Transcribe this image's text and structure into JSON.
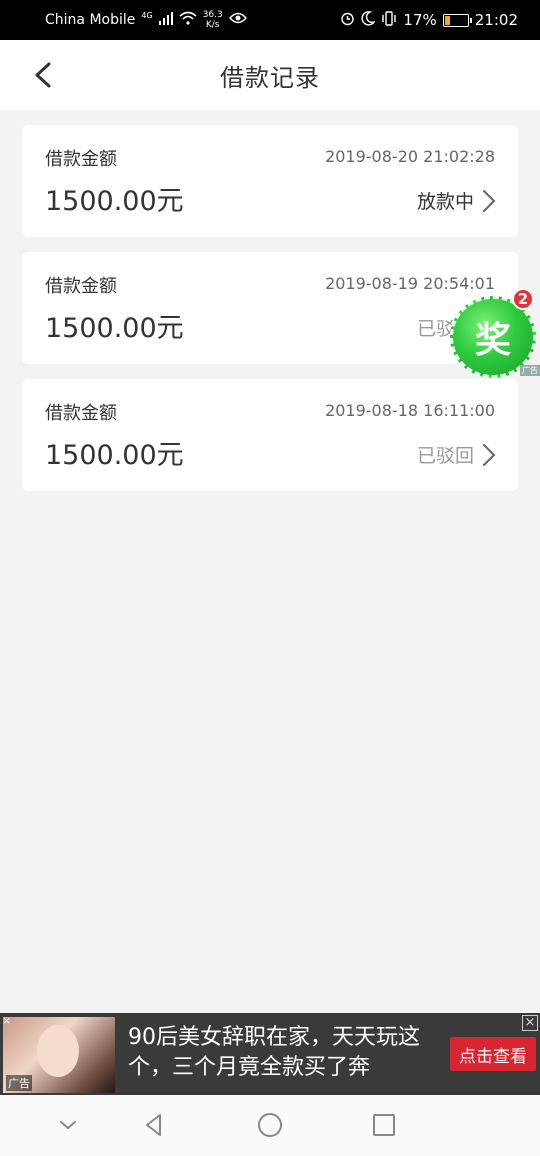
{
  "status_bar": {
    "carrier": "China Mobile",
    "network": "4G",
    "speed_value": "36.3",
    "speed_unit": "K/s",
    "battery": "17%",
    "time": "21:02"
  },
  "header": {
    "title": "借款记录"
  },
  "records": [
    {
      "label": "借款金额",
      "date": "2019-08-20 21:02:28",
      "amount": "1500.00元",
      "status": "放款中",
      "status_color": "#333333"
    },
    {
      "label": "借款金额",
      "date": "2019-08-19 20:54:01",
      "amount": "1500.00元",
      "status": "已驳回",
      "status_color": "#999999"
    },
    {
      "label": "借款金额",
      "date": "2019-08-18 16:11:00",
      "amount": "1500.00元",
      "status": "已驳回",
      "status_color": "#999999"
    }
  ],
  "reward": {
    "label": "奖",
    "badge": "2",
    "ad_tag": "广告"
  },
  "ad_banner": {
    "tag": "广告",
    "text": "90后美女辞职在家，天天玩这个，三个月竟全款买了奔",
    "button": "点击查看",
    "close": "×"
  },
  "nav_bar": {
    "icons": [
      "chevron-down-icon",
      "back-triangle-icon",
      "home-circle-icon",
      "recents-square-icon"
    ]
  },
  "colors": {
    "accent_red": "#d9252f",
    "reward_green": "#2fcb3f"
  }
}
